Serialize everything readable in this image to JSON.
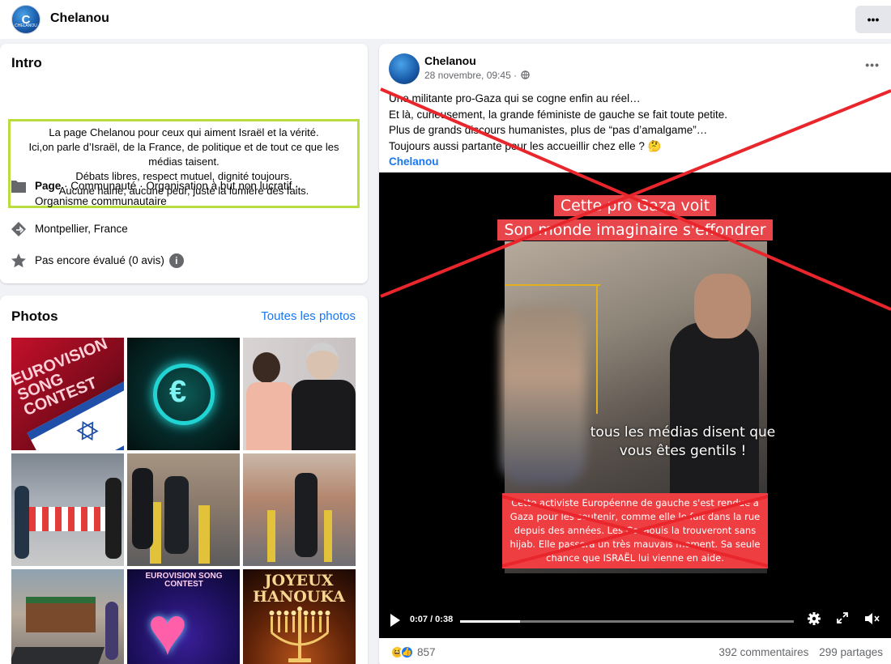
{
  "page": {
    "name": "Chelanou",
    "logo_text": "CHELANOU"
  },
  "intro": {
    "title": "Intro",
    "bio_lines": [
      "La page Chelanou pour ceux qui aiment Israël et la vérité.",
      "Ici,on parle d’Israël, de la France, de politique et de tout ce que les médias taisent.",
      "Débats libres, respect mutuel, dignité toujours.",
      "Aucune haine, aucune peur, juste la lumière des faits."
    ],
    "category_bold": "Page",
    "category_rest": " · Communauté · Organisation à but non lucratif · Organisme communautaire",
    "location": "Montpellier, France",
    "rating": "Pas encore évalué (0 avis)"
  },
  "photos": {
    "title": "Photos",
    "see_all": "Toutes les photos",
    "tiles": [
      {
        "caption": "EUROVISION SONG CONTEST"
      },
      {
        "caption": "€"
      },
      {
        "caption": ""
      },
      {
        "caption": ""
      },
      {
        "caption": ""
      },
      {
        "caption": ""
      },
      {
        "caption": ""
      },
      {
        "caption": "EUROVISION SONG CONTEST"
      },
      {
        "caption": "JOYEUX HANOUKA"
      }
    ]
  },
  "post": {
    "author": "Chelanou",
    "timestamp": "28 novembre, 09:45 ·",
    "text_lines": [
      "Une militante pro-Gaza qui se cogne enfin au réel…",
      "Et là, curieusement, la grande féministe de gauche se fait toute petite.",
      "Plus de grands discours humanistes, plus de “pas d’amalgame”…",
      "Toujours aussi partante pour les accueillir chez elle ? 🤔"
    ],
    "tag": "Chelanou",
    "video": {
      "title_line1": "Cette pro Gaza voit",
      "title_line2": "Son monde imaginaire s'effondrer",
      "subtitle": "tous les médias disent que vous êtes gentils !",
      "red_box": "Cette activiste Européenne de gauche s'est rendue à Gaza pour les soutenir, comme elle le fait dans la rue depuis des années. Les Gazaouis la trouveront sans hijab. Elle passera un très mauvais moment. Sa seule chance que ISRAËL lui vienne en aide.",
      "time": "0:07 / 0:38",
      "progress": 0.18
    },
    "reactions_count": "857",
    "comments": "392 commentaires",
    "shares": "299 partages"
  },
  "colors": {
    "accent": "#1877f2",
    "highlight_box": "#b9dc3f",
    "cross": "#e8262c",
    "video_red": "#ee3e42"
  }
}
